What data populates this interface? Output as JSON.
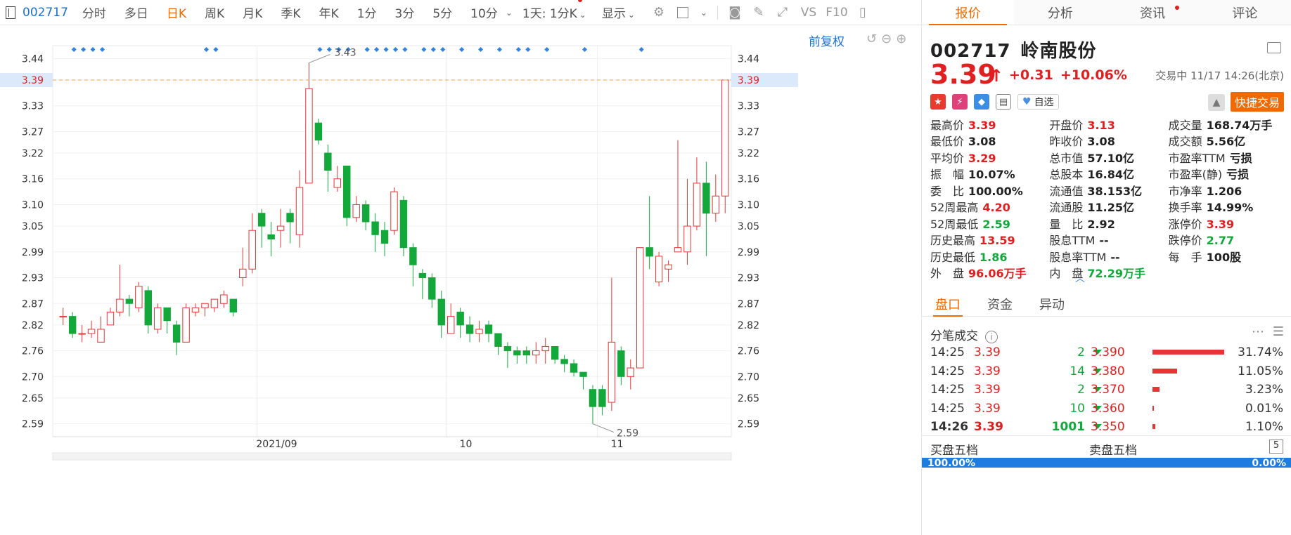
{
  "toolbar": {
    "code": "002717",
    "tabs": [
      "分时",
      "多日",
      "日K",
      "周K",
      "月K",
      "季K",
      "年K",
      "1分",
      "3分",
      "5分",
      "10分"
    ],
    "active": "日K",
    "period_select": "1天: 1分K",
    "display": "显示"
  },
  "chart": {
    "fuquan": "前复权",
    "price_ticks": [
      "3.44",
      "3.39",
      "3.33",
      "3.27",
      "3.22",
      "3.16",
      "3.10",
      "3.05",
      "2.99",
      "2.93",
      "2.87",
      "2.82",
      "2.76",
      "2.70",
      "2.65",
      "2.59"
    ],
    "current_price": "3.39",
    "high_label": "3.43",
    "low_label": "2.59",
    "x_labels": [
      "2021/09",
      "10",
      "11"
    ]
  },
  "chart_data": {
    "type": "candlestick",
    "ylim": [
      2.56,
      3.47
    ],
    "candles": [
      [
        2.84,
        2.84,
        2.86,
        2.82
      ],
      [
        2.84,
        2.8,
        2.85,
        2.79
      ],
      [
        2.8,
        2.8,
        2.82,
        2.78
      ],
      [
        2.8,
        2.81,
        2.83,
        2.79
      ],
      [
        2.78,
        2.81,
        2.84,
        2.78
      ],
      [
        2.82,
        2.85,
        2.86,
        2.82
      ],
      [
        2.85,
        2.88,
        2.96,
        2.84
      ],
      [
        2.88,
        2.87,
        2.89,
        2.84
      ],
      [
        2.86,
        2.91,
        2.92,
        2.85
      ],
      [
        2.9,
        2.82,
        2.91,
        2.8
      ],
      [
        2.81,
        2.86,
        2.87,
        2.8
      ],
      [
        2.86,
        2.83,
        2.86,
        2.8
      ],
      [
        2.82,
        2.78,
        2.83,
        2.75
      ],
      [
        2.78,
        2.86,
        2.87,
        2.78
      ],
      [
        2.85,
        2.86,
        2.87,
        2.84
      ],
      [
        2.86,
        2.87,
        2.87,
        2.84
      ],
      [
        2.86,
        2.88,
        2.88,
        2.85
      ],
      [
        2.87,
        2.89,
        2.9,
        2.86
      ],
      [
        2.88,
        2.85,
        2.88,
        2.84
      ],
      [
        2.93,
        2.95,
        3.0,
        2.91
      ],
      [
        2.95,
        3.04,
        3.08,
        2.94
      ],
      [
        3.08,
        3.05,
        3.09,
        3.0
      ],
      [
        3.03,
        3.02,
        3.06,
        2.98
      ],
      [
        3.04,
        3.05,
        3.09,
        3.0
      ],
      [
        3.08,
        3.06,
        3.09,
        3.01
      ],
      [
        3.03,
        3.14,
        3.18,
        3.0
      ],
      [
        3.15,
        3.37,
        3.43,
        3.15
      ],
      [
        3.29,
        3.25,
        3.3,
        3.24
      ],
      [
        3.22,
        3.18,
        3.24,
        3.13
      ],
      [
        3.14,
        3.16,
        3.19,
        3.13
      ],
      [
        3.19,
        3.07,
        3.19,
        3.05
      ],
      [
        3.07,
        3.1,
        3.12,
        3.06
      ],
      [
        3.1,
        3.06,
        3.11,
        3.04
      ],
      [
        3.06,
        3.03,
        3.08,
        2.99
      ],
      [
        3.04,
        3.01,
        3.06,
        2.98
      ],
      [
        3.04,
        3.13,
        3.14,
        3.03
      ],
      [
        3.11,
        3.0,
        3.12,
        2.98
      ],
      [
        3.0,
        2.96,
        3.01,
        2.91
      ],
      [
        2.94,
        2.93,
        2.95,
        2.88
      ],
      [
        2.93,
        2.88,
        2.94,
        2.86
      ],
      [
        2.88,
        2.82,
        2.9,
        2.79
      ],
      [
        2.8,
        2.84,
        2.87,
        2.8
      ],
      [
        2.85,
        2.82,
        2.86,
        2.79
      ],
      [
        2.82,
        2.8,
        2.84,
        2.78
      ],
      [
        2.8,
        2.81,
        2.83,
        2.78
      ],
      [
        2.82,
        2.8,
        2.83,
        2.78
      ],
      [
        2.8,
        2.77,
        2.8,
        2.75
      ],
      [
        2.77,
        2.76,
        2.78,
        2.72
      ],
      [
        2.76,
        2.75,
        2.77,
        2.73
      ],
      [
        2.76,
        2.75,
        2.77,
        2.73
      ],
      [
        2.75,
        2.76,
        2.78,
        2.73
      ],
      [
        2.76,
        2.77,
        2.79,
        2.73
      ],
      [
        2.77,
        2.74,
        2.77,
        2.73
      ],
      [
        2.74,
        2.73,
        2.75,
        2.71
      ],
      [
        2.73,
        2.71,
        2.74,
        2.7
      ],
      [
        2.71,
        2.7,
        2.71,
        2.67
      ],
      [
        2.67,
        2.63,
        2.68,
        2.59
      ],
      [
        2.67,
        2.63,
        2.68,
        2.61
      ],
      [
        2.64,
        2.78,
        2.93,
        2.62
      ],
      [
        2.76,
        2.7,
        2.77,
        2.68
      ],
      [
        2.7,
        2.72,
        2.74,
        2.67
      ],
      [
        2.72,
        3.0,
        3.0,
        2.72
      ],
      [
        3.0,
        2.98,
        3.12,
        2.95
      ],
      [
        2.92,
        2.98,
        2.99,
        2.91
      ],
      [
        2.95,
        2.96,
        2.97,
        2.92
      ],
      [
        2.99,
        3.0,
        3.25,
        2.99
      ],
      [
        2.99,
        3.05,
        3.16,
        2.96
      ],
      [
        3.05,
        3.15,
        3.21,
        3.04
      ],
      [
        3.15,
        3.08,
        3.2,
        2.98
      ],
      [
        3.08,
        3.12,
        3.17,
        3.06
      ],
      [
        3.12,
        3.39,
        3.39,
        3.08
      ]
    ]
  },
  "header": {
    "tabs": [
      "报价",
      "分析",
      "资讯",
      "评论"
    ],
    "active": "报价",
    "code": "002717",
    "name": "岭南股份",
    "price": "3.39",
    "arrow": "↑",
    "change": "+0.31",
    "pct": "+10.06%",
    "trade_time": "交易中 11/17 14:26(北京)",
    "watch_label": "自选",
    "quick_trade": "快捷交易"
  },
  "quote": [
    [
      {
        "l": "最高价",
        "v": "3.39",
        "c": "red"
      },
      {
        "l": "开盘价",
        "v": "3.13",
        "c": "red"
      },
      {
        "l": "成交量",
        "v": "168.74万手",
        "c": "dark"
      }
    ],
    [
      {
        "l": "最低价",
        "v": "3.08",
        "c": "dark"
      },
      {
        "l": "昨收价",
        "v": "3.08",
        "c": "dark"
      },
      {
        "l": "成交额",
        "v": "5.56亿",
        "c": "dark"
      }
    ],
    [
      {
        "l": "平均价",
        "v": "3.29",
        "c": "red"
      },
      {
        "l": "总市值",
        "v": "57.10亿",
        "c": "dark"
      },
      {
        "l": "市盈率TTM",
        "v": "亏损",
        "c": "dark"
      }
    ],
    [
      {
        "l": "振　幅",
        "v": "10.07%",
        "c": "dark"
      },
      {
        "l": "总股本",
        "v": "16.84亿",
        "c": "dark"
      },
      {
        "l": "市盈率(静)",
        "v": "亏损",
        "c": "dark"
      }
    ],
    [
      {
        "l": "委　比",
        "v": "100.00%",
        "c": "dark"
      },
      {
        "l": "流通值",
        "v": "38.153亿",
        "c": "dark"
      },
      {
        "l": "市净率",
        "v": "1.206",
        "c": "dark"
      }
    ],
    [
      {
        "l": "52周最高",
        "v": "4.20",
        "c": "red"
      },
      {
        "l": "流通股",
        "v": "11.25亿",
        "c": "dark"
      },
      {
        "l": "换手率",
        "v": "14.99%",
        "c": "dark"
      }
    ],
    [
      {
        "l": "52周最低",
        "v": "2.59",
        "c": "green"
      },
      {
        "l": "量　比",
        "v": "2.92",
        "c": "dark"
      },
      {
        "l": "涨停价",
        "v": "3.39",
        "c": "red"
      }
    ],
    [
      {
        "l": "历史最高",
        "v": "13.59",
        "c": "red"
      },
      {
        "l": "股息TTM",
        "v": "--",
        "c": "dark"
      },
      {
        "l": "跌停价",
        "v": "2.77",
        "c": "green"
      }
    ],
    [
      {
        "l": "历史最低",
        "v": "1.86",
        "c": "green"
      },
      {
        "l": "股息率TTM",
        "v": "--",
        "c": "dark"
      },
      {
        "l": "每　手",
        "v": "100股",
        "c": "dark"
      }
    ],
    [
      {
        "l": "外　盘",
        "v": "96.06万手",
        "c": "red"
      },
      {
        "l": "内　盘",
        "v": "72.29万手",
        "c": "green"
      },
      {
        "l": "",
        "v": "",
        "c": "dark"
      }
    ]
  ],
  "subtabs": [
    "盘口",
    "资金",
    "异动"
  ],
  "ticks_title": "分笔成交",
  "ticks": [
    {
      "t": "14:25",
      "p": "3.39",
      "v": "2",
      "bp": "3.390",
      "pct": "31.74%",
      "frac": 0.3174
    },
    {
      "t": "14:25",
      "p": "3.39",
      "v": "14",
      "bp": "3.380",
      "pct": "11.05%",
      "frac": 0.1105
    },
    {
      "t": "14:25",
      "p": "3.39",
      "v": "2",
      "bp": "3.370",
      "pct": "3.23%",
      "frac": 0.0323
    },
    {
      "t": "14:25",
      "p": "3.39",
      "v": "10",
      "bp": "3.360",
      "pct": "0.01%",
      "frac": 0.0001
    },
    {
      "t": "14:26",
      "p": "3.39",
      "v": "1001",
      "bp": "3.350",
      "pct": "1.10%",
      "frac": 0.011
    }
  ],
  "five": {
    "buy": "买盘五档",
    "sell": "卖盘五档",
    "buy_pct": "100.00%",
    "sell_pct": "0.00%"
  }
}
